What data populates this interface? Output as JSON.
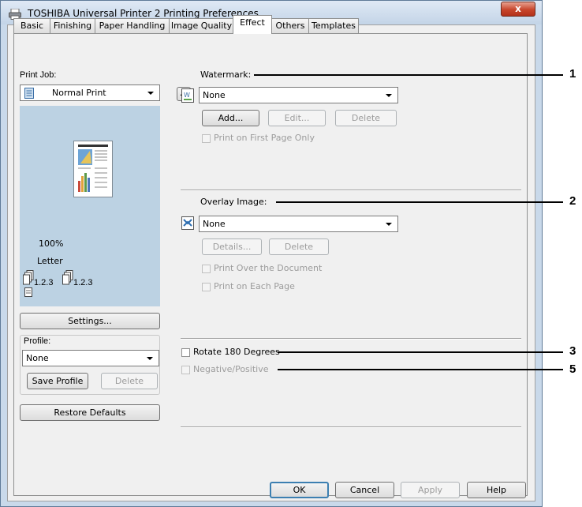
{
  "window": {
    "title": "TOSHIBA Universal Printer 2 Printing Preferences",
    "close_label": "x"
  },
  "tabs": [
    {
      "label": "Basic"
    },
    {
      "label": "Finishing"
    },
    {
      "label": "Paper Handling"
    },
    {
      "label": "Image Quality"
    },
    {
      "label": "Effect"
    },
    {
      "label": "Others"
    },
    {
      "label": "Templates"
    }
  ],
  "active_tab": "Effect",
  "left_panel": {
    "print_job_label": "Print Job:",
    "print_job_value": "Normal Print",
    "ellipsis_label": "...",
    "zoom": "100%",
    "paper": "Letter",
    "collate_a": "1.2.3",
    "collate_b": "1.2.3",
    "settings_label": "Settings...",
    "profile_label": "Profile:",
    "profile_value": "None",
    "save_profile_label": "Save Profile",
    "delete_profile_label": "Delete",
    "restore_defaults_label": "Restore Defaults"
  },
  "watermark": {
    "label": "Watermark:",
    "value": "None",
    "add_label": "Add...",
    "edit_label": "Edit...",
    "delete_label": "Delete",
    "first_page_only_label": "Print on First Page Only"
  },
  "overlay": {
    "label": "Overlay Image:",
    "value": "None",
    "details_label": "Details...",
    "delete_label": "Delete",
    "print_over_label": "Print Over the Document",
    "print_each_label": "Print on Each Page"
  },
  "rotate_label": "Rotate 180 Degrees",
  "negpos_label": "Negative/Positive",
  "footer": {
    "ok_label": "OK",
    "cancel_label": "Cancel",
    "apply_label": "Apply",
    "help_label": "Help"
  },
  "callouts": [
    "1",
    "2",
    "3",
    "5"
  ],
  "colors": {
    "preview_bg": "#bcd2e3",
    "close_red": "#c7452b",
    "default_button_border": "#3c7fb1"
  }
}
